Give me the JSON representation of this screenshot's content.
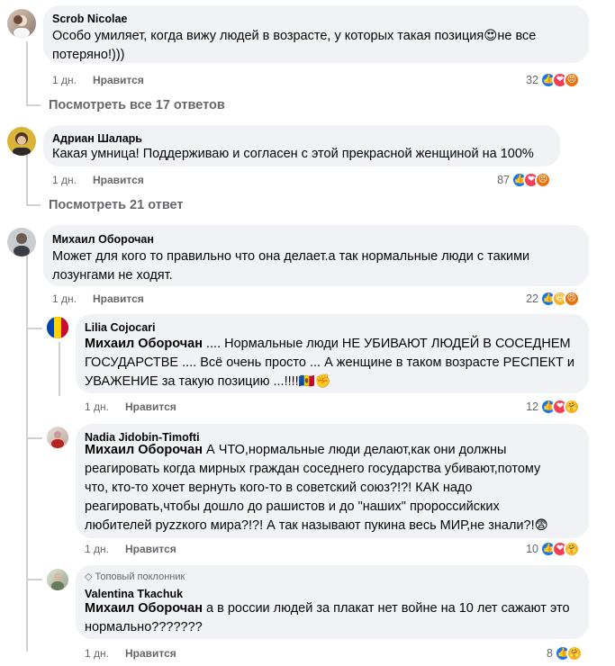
{
  "comments": [
    {
      "author": "Scrob Nicolae",
      "text_line1": "Особо умиляет, когда вижу людей в возрасте, у которых такая позиция",
      "text_emoji": "😍",
      "text_line1_end": "не все",
      "text_line2": "потеряно!)))",
      "time": "1 дн.",
      "like_label": "Нравится",
      "reaction_count": "32",
      "reactions": [
        "like-icon",
        "love-icon",
        "angry-icon"
      ],
      "view_replies": "Посмотреть все 17 ответов"
    },
    {
      "author": "Адриан Шаларь",
      "text_line1": "Какая умница! Поддерживаю и согласен с этой прекрасной женщиной на 100%",
      "time": "1 дн.",
      "like_label": "Нравится",
      "reaction_count": "87",
      "reactions": [
        "like-icon",
        "love-icon",
        "angry-icon"
      ],
      "view_replies": "Посмотреть 21 ответ"
    },
    {
      "author": "Михаил Оборочан",
      "text_line1": "Может для кого то правильно что она делает.а так нормальные люди с такими",
      "text_line2": "лозунгами не ходят.",
      "time": "1 дн.",
      "like_label": "Нравится",
      "reaction_count": "22",
      "reactions": [
        "like-icon",
        "haha-icon",
        "angry-icon"
      ]
    }
  ],
  "replies": [
    {
      "author": "Lilia Cojocari",
      "mention": "Михаил Оборочан",
      "text_line1_rest": " .... Нормальные люди НЕ УБИВАЮТ ЛЮДЕЙ В СОСЕДНЕМ",
      "text_line2": "ГОСУДАРСТВЕ .... Всё очень просто ... А женщине в таком возрасте РЕСПЕКТ и",
      "text_line3": "УВАЖЕНИЕ за такую позицию ...!!!!🇲🇩✊",
      "time": "1 дн.",
      "like_label": "Нравится",
      "reaction_count": "12",
      "reactions": [
        "like-icon",
        "love-icon",
        "care-icon"
      ]
    },
    {
      "author": "Nadia Jidobin-Timofti",
      "mention": "Михаил Оборочан",
      "text_line1_rest": " А ЧТО,нормальные люди делают,как они должны",
      "text_line2": "реагировать когда мирных граждан соседнего государства убивают,потому",
      "text_line3": "что, кто-то хочет вернуть кого-то в советский союз?!?! КАК надо",
      "text_line4": "реагировать,чтобы дошло до рашистов и до \"наших\" пророссийских",
      "text_line5": "любителей руzzкого мира?!?! А так называют пукина весь МИР,не знали?!😨",
      "time": "1 дн.",
      "like_label": "Нравится",
      "reaction_count": "10",
      "reactions": [
        "like-icon",
        "love-icon",
        "care-icon"
      ]
    },
    {
      "badge": "Топовый поклонник",
      "author": "Valentina Tkachuk",
      "mention": "Михаил Оборочан",
      "text_line1_rest": " а в россии людей за плакат нет войне на 10 лет сажают это",
      "text_line2": "нормально???????",
      "time": "1 дн.",
      "like_label": "Нравится",
      "reaction_count": "8",
      "reactions": [
        "like-icon",
        "care-icon"
      ]
    }
  ],
  "colors": {
    "like": "#1877f2",
    "love": "#f33e58",
    "angry": "#e9710f",
    "haha": "#f7b125",
    "bubble": "#f0f2f5",
    "muted": "#65676b"
  }
}
